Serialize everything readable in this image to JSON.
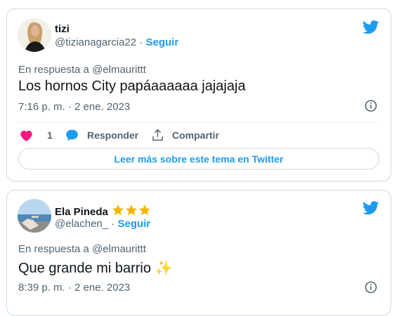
{
  "tweets": [
    {
      "display_name": "tizi",
      "handle": "@tizianagarcia22",
      "separator": "·",
      "follow_label": "Seguir",
      "reply_to": "En respuesta a @elmaurittt",
      "text": "Los hornos City papáaaaaaa jajajaja",
      "timestamp": "7:16 p. m. · 2 ene. 2023",
      "likes": "1",
      "reply_label": "Responder",
      "share_label": "Compartir",
      "read_more_label": "Leer más sobre este tema en Twitter"
    },
    {
      "display_name": "Ela Pineda",
      "handle": "@elachen_",
      "separator": "·",
      "follow_label": "Seguir",
      "reply_to": "En respuesta a @elmaurittt",
      "text": "Que grande mi barrio ✨",
      "timestamp": "8:39 p. m. · 2 ene. 2023"
    }
  ],
  "colors": {
    "accent": "#1d9bf0",
    "like": "#f91880",
    "muted": "#536471",
    "border": "#cfd9de",
    "star": "#f4b400"
  }
}
